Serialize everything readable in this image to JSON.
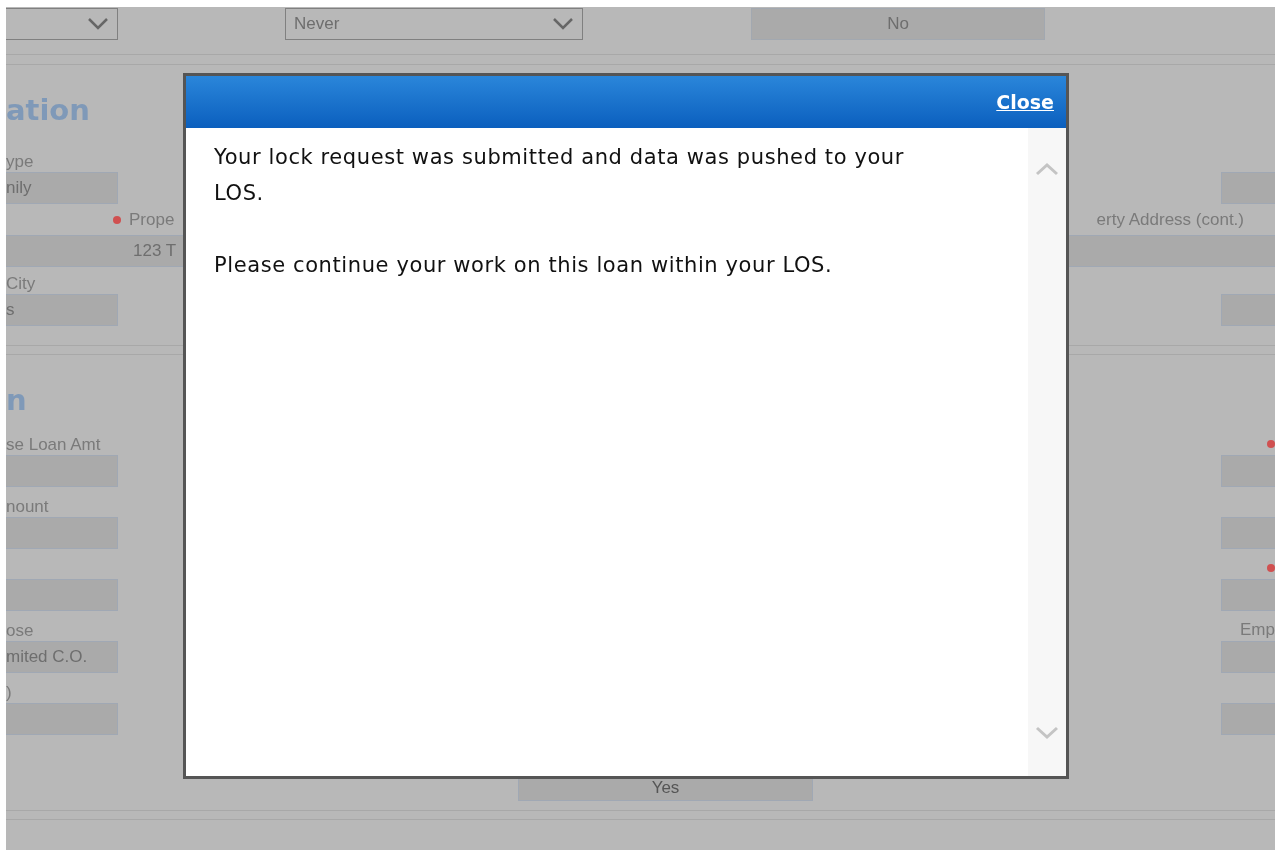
{
  "top_row": {
    "second_select": {
      "value": "Never"
    },
    "third_field": {
      "value": "No"
    }
  },
  "property_section": {
    "heading": "ation",
    "type_label": "ype",
    "type_value": "nily",
    "address_label": "Prope",
    "address_required": true,
    "address_value": "123 T",
    "address_cont_label": "erty Address (cont.)",
    "city_label": "City",
    "city_value": "s"
  },
  "loan_section": {
    "heading": "n",
    "left_fields": [
      {
        "kind": "labeled",
        "label": "se Loan Amt"
      },
      {
        "kind": "labeled",
        "label": "nount"
      },
      {
        "kind": "bare"
      },
      {
        "kind": "labeled",
        "label": "ose",
        "value": "mited C.O."
      },
      {
        "kind": "labeled",
        "label": ")"
      }
    ],
    "right_fields": [
      {
        "required": true
      },
      {
        "required": false
      },
      {
        "required": true
      },
      {
        "label": "Emp",
        "required": false
      },
      {
        "required": false
      }
    ]
  },
  "bottom_field": {
    "value": "Yes"
  },
  "dialog": {
    "close_label": "Close",
    "paragraphs": [
      "Your lock request was submitted and data was pushed to your LOS.",
      "Please continue your work on this loan within your LOS."
    ]
  }
}
